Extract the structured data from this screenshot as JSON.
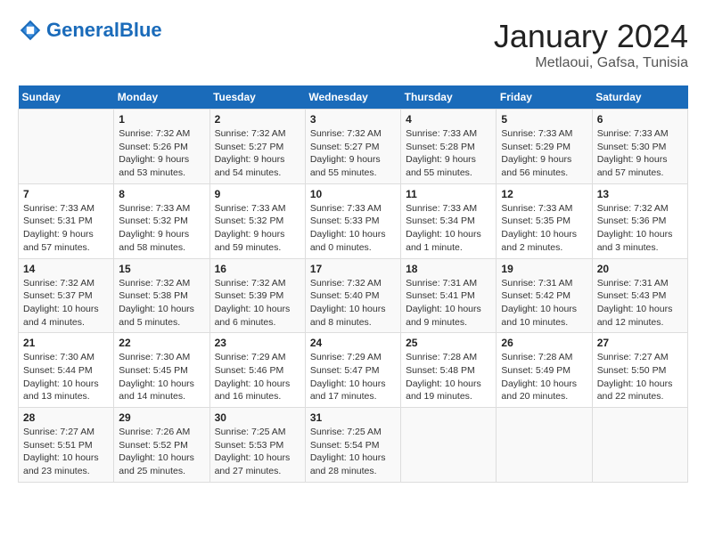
{
  "header": {
    "logo_text_general": "General",
    "logo_text_blue": "Blue",
    "month_title": "January 2024",
    "location": "Metlaoui, Gafsa, Tunisia"
  },
  "days_of_week": [
    "Sunday",
    "Monday",
    "Tuesday",
    "Wednesday",
    "Thursday",
    "Friday",
    "Saturday"
  ],
  "weeks": [
    [
      {
        "day": "",
        "sunrise": "",
        "sunset": "",
        "daylight": ""
      },
      {
        "day": "1",
        "sunrise": "Sunrise: 7:32 AM",
        "sunset": "Sunset: 5:26 PM",
        "daylight": "Daylight: 9 hours and 53 minutes."
      },
      {
        "day": "2",
        "sunrise": "Sunrise: 7:32 AM",
        "sunset": "Sunset: 5:27 PM",
        "daylight": "Daylight: 9 hours and 54 minutes."
      },
      {
        "day": "3",
        "sunrise": "Sunrise: 7:32 AM",
        "sunset": "Sunset: 5:27 PM",
        "daylight": "Daylight: 9 hours and 55 minutes."
      },
      {
        "day": "4",
        "sunrise": "Sunrise: 7:33 AM",
        "sunset": "Sunset: 5:28 PM",
        "daylight": "Daylight: 9 hours and 55 minutes."
      },
      {
        "day": "5",
        "sunrise": "Sunrise: 7:33 AM",
        "sunset": "Sunset: 5:29 PM",
        "daylight": "Daylight: 9 hours and 56 minutes."
      },
      {
        "day": "6",
        "sunrise": "Sunrise: 7:33 AM",
        "sunset": "Sunset: 5:30 PM",
        "daylight": "Daylight: 9 hours and 57 minutes."
      }
    ],
    [
      {
        "day": "7",
        "sunrise": "Sunrise: 7:33 AM",
        "sunset": "Sunset: 5:31 PM",
        "daylight": "Daylight: 9 hours and 57 minutes."
      },
      {
        "day": "8",
        "sunrise": "Sunrise: 7:33 AM",
        "sunset": "Sunset: 5:32 PM",
        "daylight": "Daylight: 9 hours and 58 minutes."
      },
      {
        "day": "9",
        "sunrise": "Sunrise: 7:33 AM",
        "sunset": "Sunset: 5:32 PM",
        "daylight": "Daylight: 9 hours and 59 minutes."
      },
      {
        "day": "10",
        "sunrise": "Sunrise: 7:33 AM",
        "sunset": "Sunset: 5:33 PM",
        "daylight": "Daylight: 10 hours and 0 minutes."
      },
      {
        "day": "11",
        "sunrise": "Sunrise: 7:33 AM",
        "sunset": "Sunset: 5:34 PM",
        "daylight": "Daylight: 10 hours and 1 minute."
      },
      {
        "day": "12",
        "sunrise": "Sunrise: 7:33 AM",
        "sunset": "Sunset: 5:35 PM",
        "daylight": "Daylight: 10 hours and 2 minutes."
      },
      {
        "day": "13",
        "sunrise": "Sunrise: 7:32 AM",
        "sunset": "Sunset: 5:36 PM",
        "daylight": "Daylight: 10 hours and 3 minutes."
      }
    ],
    [
      {
        "day": "14",
        "sunrise": "Sunrise: 7:32 AM",
        "sunset": "Sunset: 5:37 PM",
        "daylight": "Daylight: 10 hours and 4 minutes."
      },
      {
        "day": "15",
        "sunrise": "Sunrise: 7:32 AM",
        "sunset": "Sunset: 5:38 PM",
        "daylight": "Daylight: 10 hours and 5 minutes."
      },
      {
        "day": "16",
        "sunrise": "Sunrise: 7:32 AM",
        "sunset": "Sunset: 5:39 PM",
        "daylight": "Daylight: 10 hours and 6 minutes."
      },
      {
        "day": "17",
        "sunrise": "Sunrise: 7:32 AM",
        "sunset": "Sunset: 5:40 PM",
        "daylight": "Daylight: 10 hours and 8 minutes."
      },
      {
        "day": "18",
        "sunrise": "Sunrise: 7:31 AM",
        "sunset": "Sunset: 5:41 PM",
        "daylight": "Daylight: 10 hours and 9 minutes."
      },
      {
        "day": "19",
        "sunrise": "Sunrise: 7:31 AM",
        "sunset": "Sunset: 5:42 PM",
        "daylight": "Daylight: 10 hours and 10 minutes."
      },
      {
        "day": "20",
        "sunrise": "Sunrise: 7:31 AM",
        "sunset": "Sunset: 5:43 PM",
        "daylight": "Daylight: 10 hours and 12 minutes."
      }
    ],
    [
      {
        "day": "21",
        "sunrise": "Sunrise: 7:30 AM",
        "sunset": "Sunset: 5:44 PM",
        "daylight": "Daylight: 10 hours and 13 minutes."
      },
      {
        "day": "22",
        "sunrise": "Sunrise: 7:30 AM",
        "sunset": "Sunset: 5:45 PM",
        "daylight": "Daylight: 10 hours and 14 minutes."
      },
      {
        "day": "23",
        "sunrise": "Sunrise: 7:29 AM",
        "sunset": "Sunset: 5:46 PM",
        "daylight": "Daylight: 10 hours and 16 minutes."
      },
      {
        "day": "24",
        "sunrise": "Sunrise: 7:29 AM",
        "sunset": "Sunset: 5:47 PM",
        "daylight": "Daylight: 10 hours and 17 minutes."
      },
      {
        "day": "25",
        "sunrise": "Sunrise: 7:28 AM",
        "sunset": "Sunset: 5:48 PM",
        "daylight": "Daylight: 10 hours and 19 minutes."
      },
      {
        "day": "26",
        "sunrise": "Sunrise: 7:28 AM",
        "sunset": "Sunset: 5:49 PM",
        "daylight": "Daylight: 10 hours and 20 minutes."
      },
      {
        "day": "27",
        "sunrise": "Sunrise: 7:27 AM",
        "sunset": "Sunset: 5:50 PM",
        "daylight": "Daylight: 10 hours and 22 minutes."
      }
    ],
    [
      {
        "day": "28",
        "sunrise": "Sunrise: 7:27 AM",
        "sunset": "Sunset: 5:51 PM",
        "daylight": "Daylight: 10 hours and 23 minutes."
      },
      {
        "day": "29",
        "sunrise": "Sunrise: 7:26 AM",
        "sunset": "Sunset: 5:52 PM",
        "daylight": "Daylight: 10 hours and 25 minutes."
      },
      {
        "day": "30",
        "sunrise": "Sunrise: 7:25 AM",
        "sunset": "Sunset: 5:53 PM",
        "daylight": "Daylight: 10 hours and 27 minutes."
      },
      {
        "day": "31",
        "sunrise": "Sunrise: 7:25 AM",
        "sunset": "Sunset: 5:54 PM",
        "daylight": "Daylight: 10 hours and 28 minutes."
      },
      {
        "day": "",
        "sunrise": "",
        "sunset": "",
        "daylight": ""
      },
      {
        "day": "",
        "sunrise": "",
        "sunset": "",
        "daylight": ""
      },
      {
        "day": "",
        "sunrise": "",
        "sunset": "",
        "daylight": ""
      }
    ]
  ]
}
